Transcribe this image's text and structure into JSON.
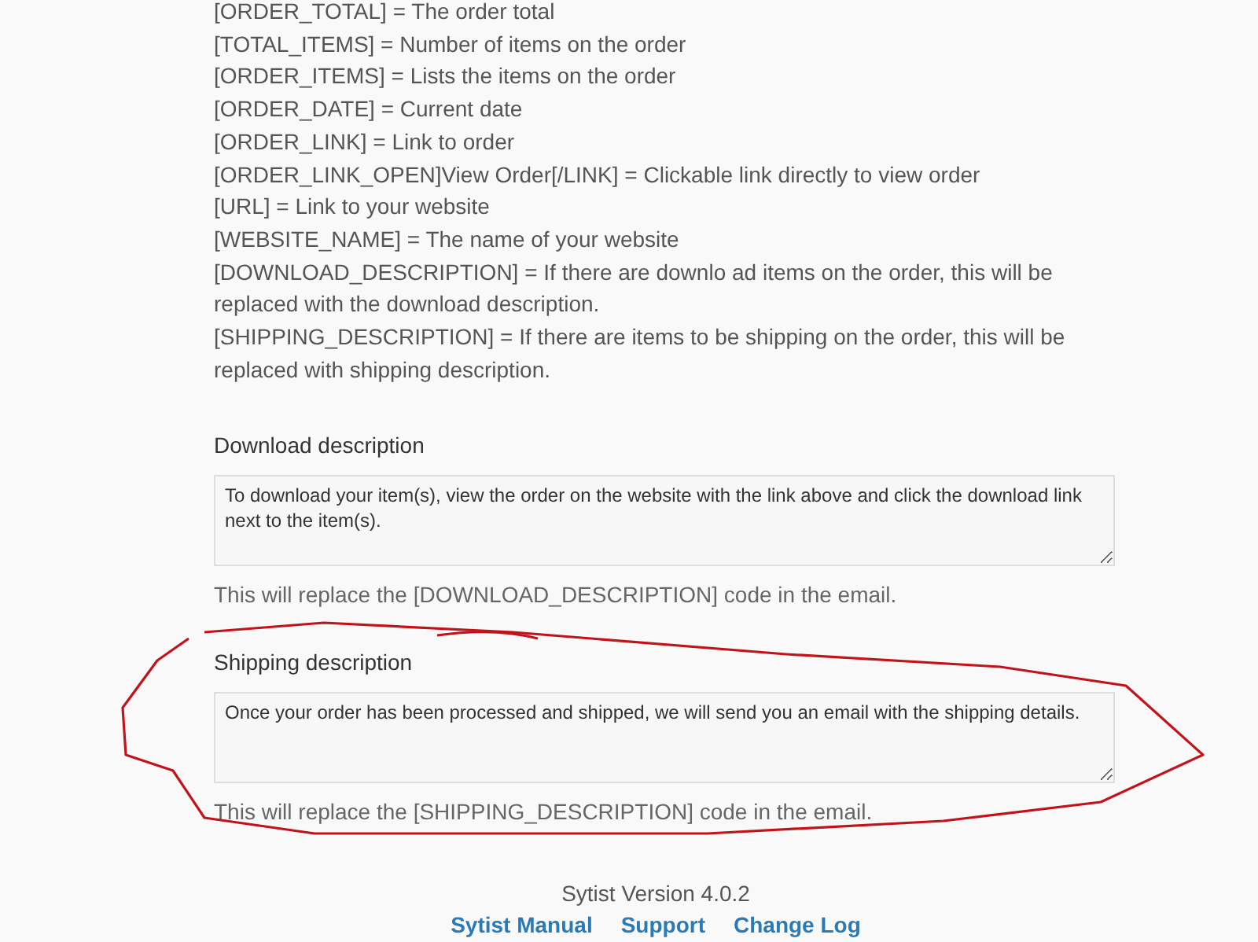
{
  "codes": [
    "[ORDER_TOTAL] = The order total",
    "[TOTAL_ITEMS] = Number of items on the order",
    "[ORDER_ITEMS] = Lists the items on the order",
    "[ORDER_DATE] = Current date",
    "[ORDER_LINK] = Link to order",
    "[ORDER_LINK_OPEN]View Order[/LINK] = Clickable link directly to view order",
    "[URL] = Link to your website",
    "[WEBSITE_NAME] = The name of your website",
    "[DOWNLOAD_DESCRIPTION] = If there are downlo ad items on the order, this will be replaced with the download description.",
    "[SHIPPING_DESCRIPTION] = If there are items to be shipping on the order, this will be replaced with shipping description."
  ],
  "fields": [
    {
      "label": "Download description",
      "value": "To download your item(s), view the order on the website with the link above and click the download link next to the item(s).",
      "help": "This will replace the [DOWNLOAD_DESCRIPTION] code in the email."
    },
    {
      "label": "Shipping description",
      "value": "Once your order has been processed and shipped, we will send you an email with the shipping details.",
      "help": "This will replace the [SHIPPING_DESCRIPTION] code in the email."
    }
  ],
  "footer": {
    "version": "Sytist Version 4.0.2",
    "links": [
      "Sytist Manual",
      "Support",
      "Change Log"
    ]
  }
}
